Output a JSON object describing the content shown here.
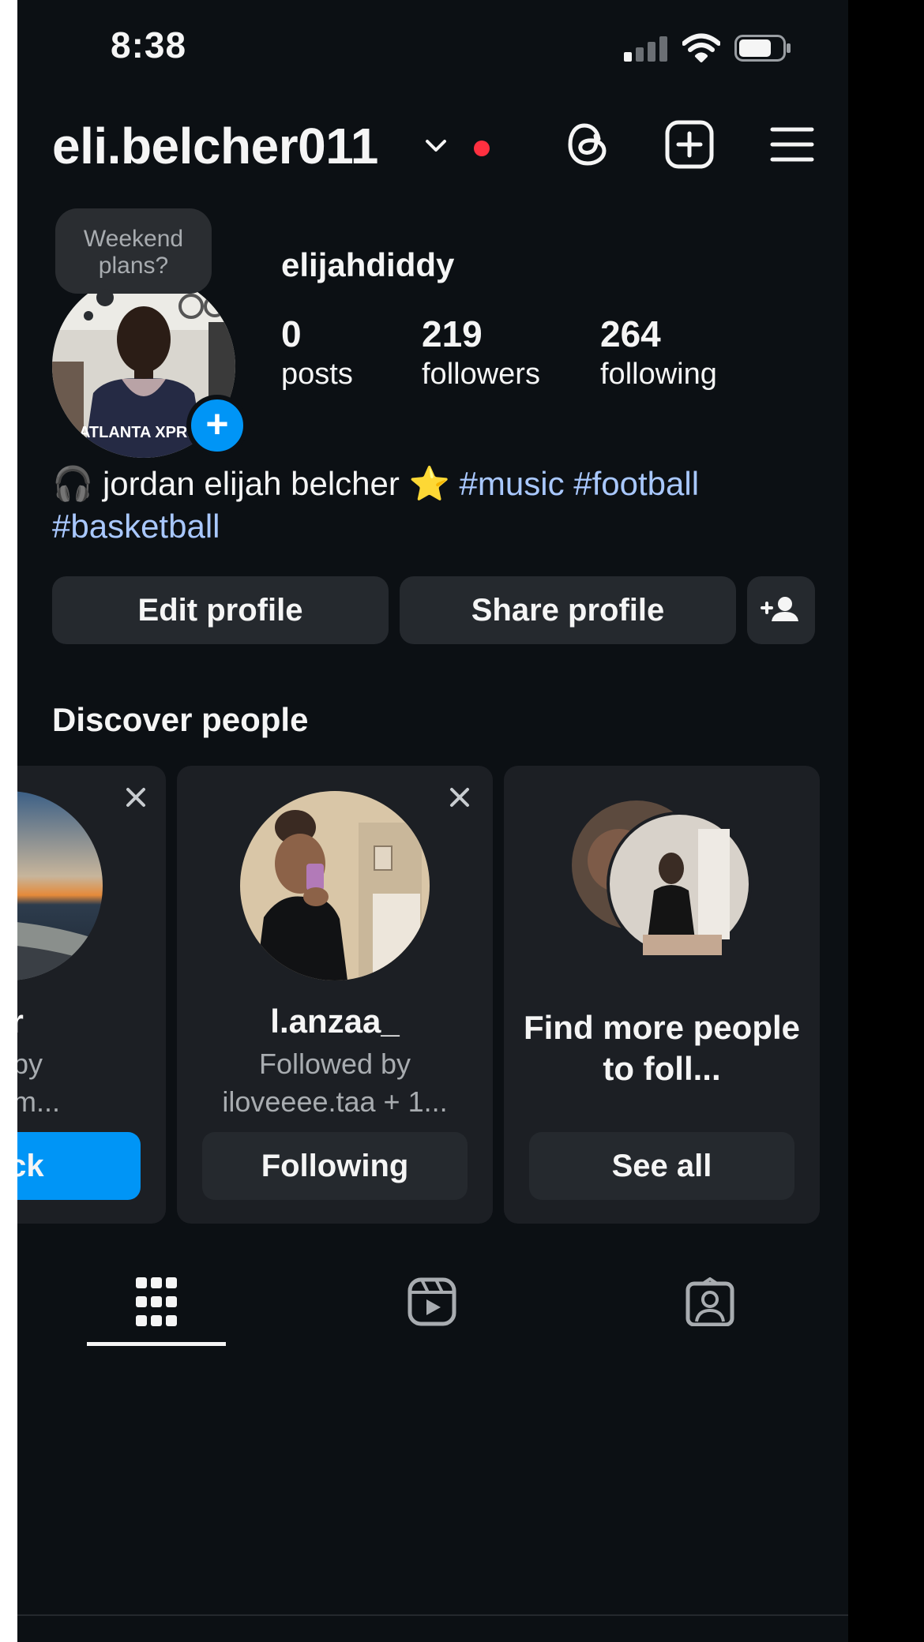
{
  "status_bar": {
    "time": "8:38"
  },
  "header": {
    "username": "eli.belcher011",
    "icons": [
      "chevron-down-icon",
      "threads-icon",
      "create-post-icon",
      "menu-icon"
    ]
  },
  "profile": {
    "note": "Weekend plans?",
    "display_name": "elijahdiddy",
    "stats": [
      {
        "value": "0",
        "label": "posts"
      },
      {
        "value": "219",
        "label": "followers"
      },
      {
        "value": "264",
        "label": "following"
      }
    ],
    "bio": {
      "emoji_headphones": "🎧",
      "text": "jordan elijah belcher",
      "emoji_star": "⭐",
      "tags": [
        "#music",
        "#football",
        "#basketball"
      ]
    },
    "avatar_jersey_text": "ATLANTA XPRES"
  },
  "actions": {
    "edit": "Edit profile",
    "share": "Share profile"
  },
  "discover": {
    "title": "Discover people",
    "cards": [
      {
        "name": "ar",
        "sub1": "ed by",
        "sub2": "raham...",
        "button": "back"
      },
      {
        "name": "l.anzaa_",
        "sub1": "Followed by",
        "sub2": "iloveeee.taa + 1...",
        "button": "Following"
      },
      {
        "name": "Find more people to foll...",
        "button": "See all"
      }
    ]
  },
  "colors": {
    "background": "#0c1014",
    "accent": "#0095f6",
    "hashtag": "#a9c8ff",
    "notification": "#ff3040"
  },
  "tabs": [
    "grid-icon",
    "reels-icon",
    "tagged-icon"
  ]
}
